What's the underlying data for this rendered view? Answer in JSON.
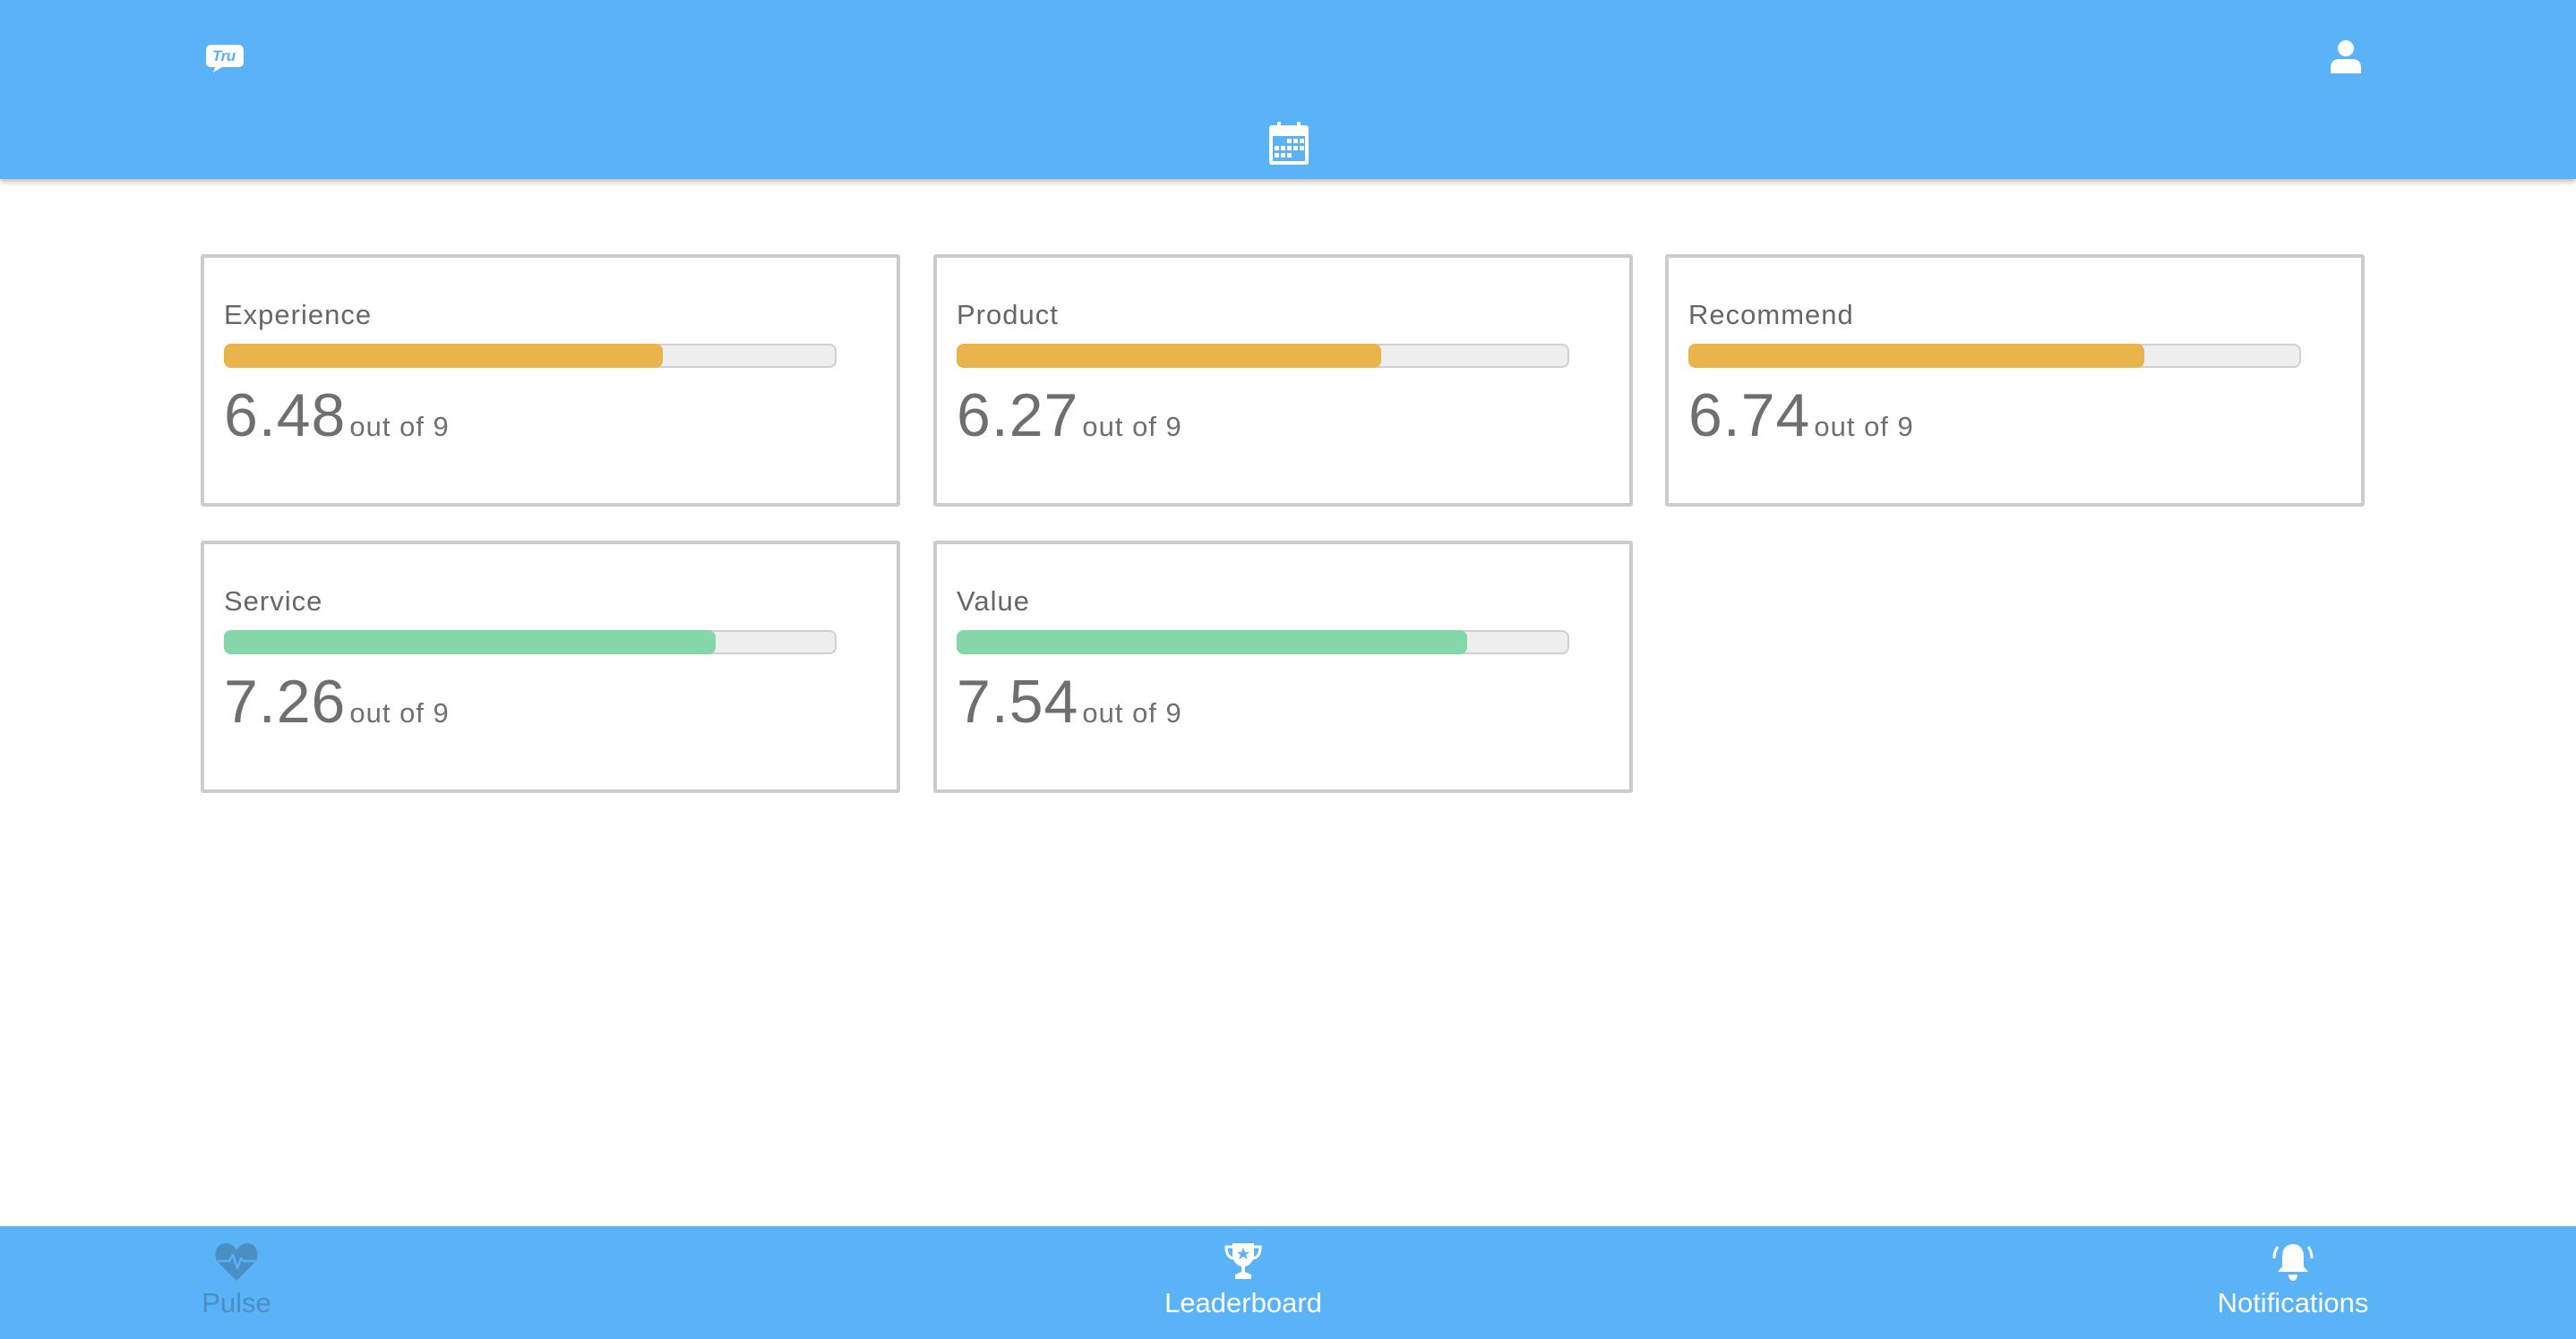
{
  "header": {
    "logo_text": "Tru",
    "icons": [
      "logo-icon",
      "user-icon",
      "calendar-icon"
    ]
  },
  "colors": {
    "header_bg": "#5ab2f7",
    "bar_warning": "#e9b44c",
    "bar_good": "#84d7a8",
    "bar_track": "#eeeeee",
    "nav_active": "#4a8fc4",
    "nav_inactive": "#ffffff"
  },
  "metrics": [
    {
      "label": "Experience",
      "value": "6.48",
      "out_of": "out of 9",
      "fraction": 0.72,
      "status": "warning"
    },
    {
      "label": "Product",
      "value": "6.27",
      "out_of": "out of 9",
      "fraction": 0.697,
      "status": "warning"
    },
    {
      "label": "Recommend",
      "value": "6.74",
      "out_of": "out of 9",
      "fraction": 0.749,
      "status": "warning"
    },
    {
      "label": "Service",
      "value": "7.26",
      "out_of": "out of 9",
      "fraction": 0.807,
      "status": "good"
    },
    {
      "label": "Value",
      "value": "7.54",
      "out_of": "out of 9",
      "fraction": 0.838,
      "status": "good"
    }
  ],
  "bottom_nav": [
    {
      "label": "Pulse",
      "icon": "heart-pulse-icon",
      "active": true
    },
    {
      "label": "Leaderboard",
      "icon": "trophy-icon",
      "active": false
    },
    {
      "label": "Notifications",
      "icon": "bell-icon",
      "active": false
    }
  ]
}
